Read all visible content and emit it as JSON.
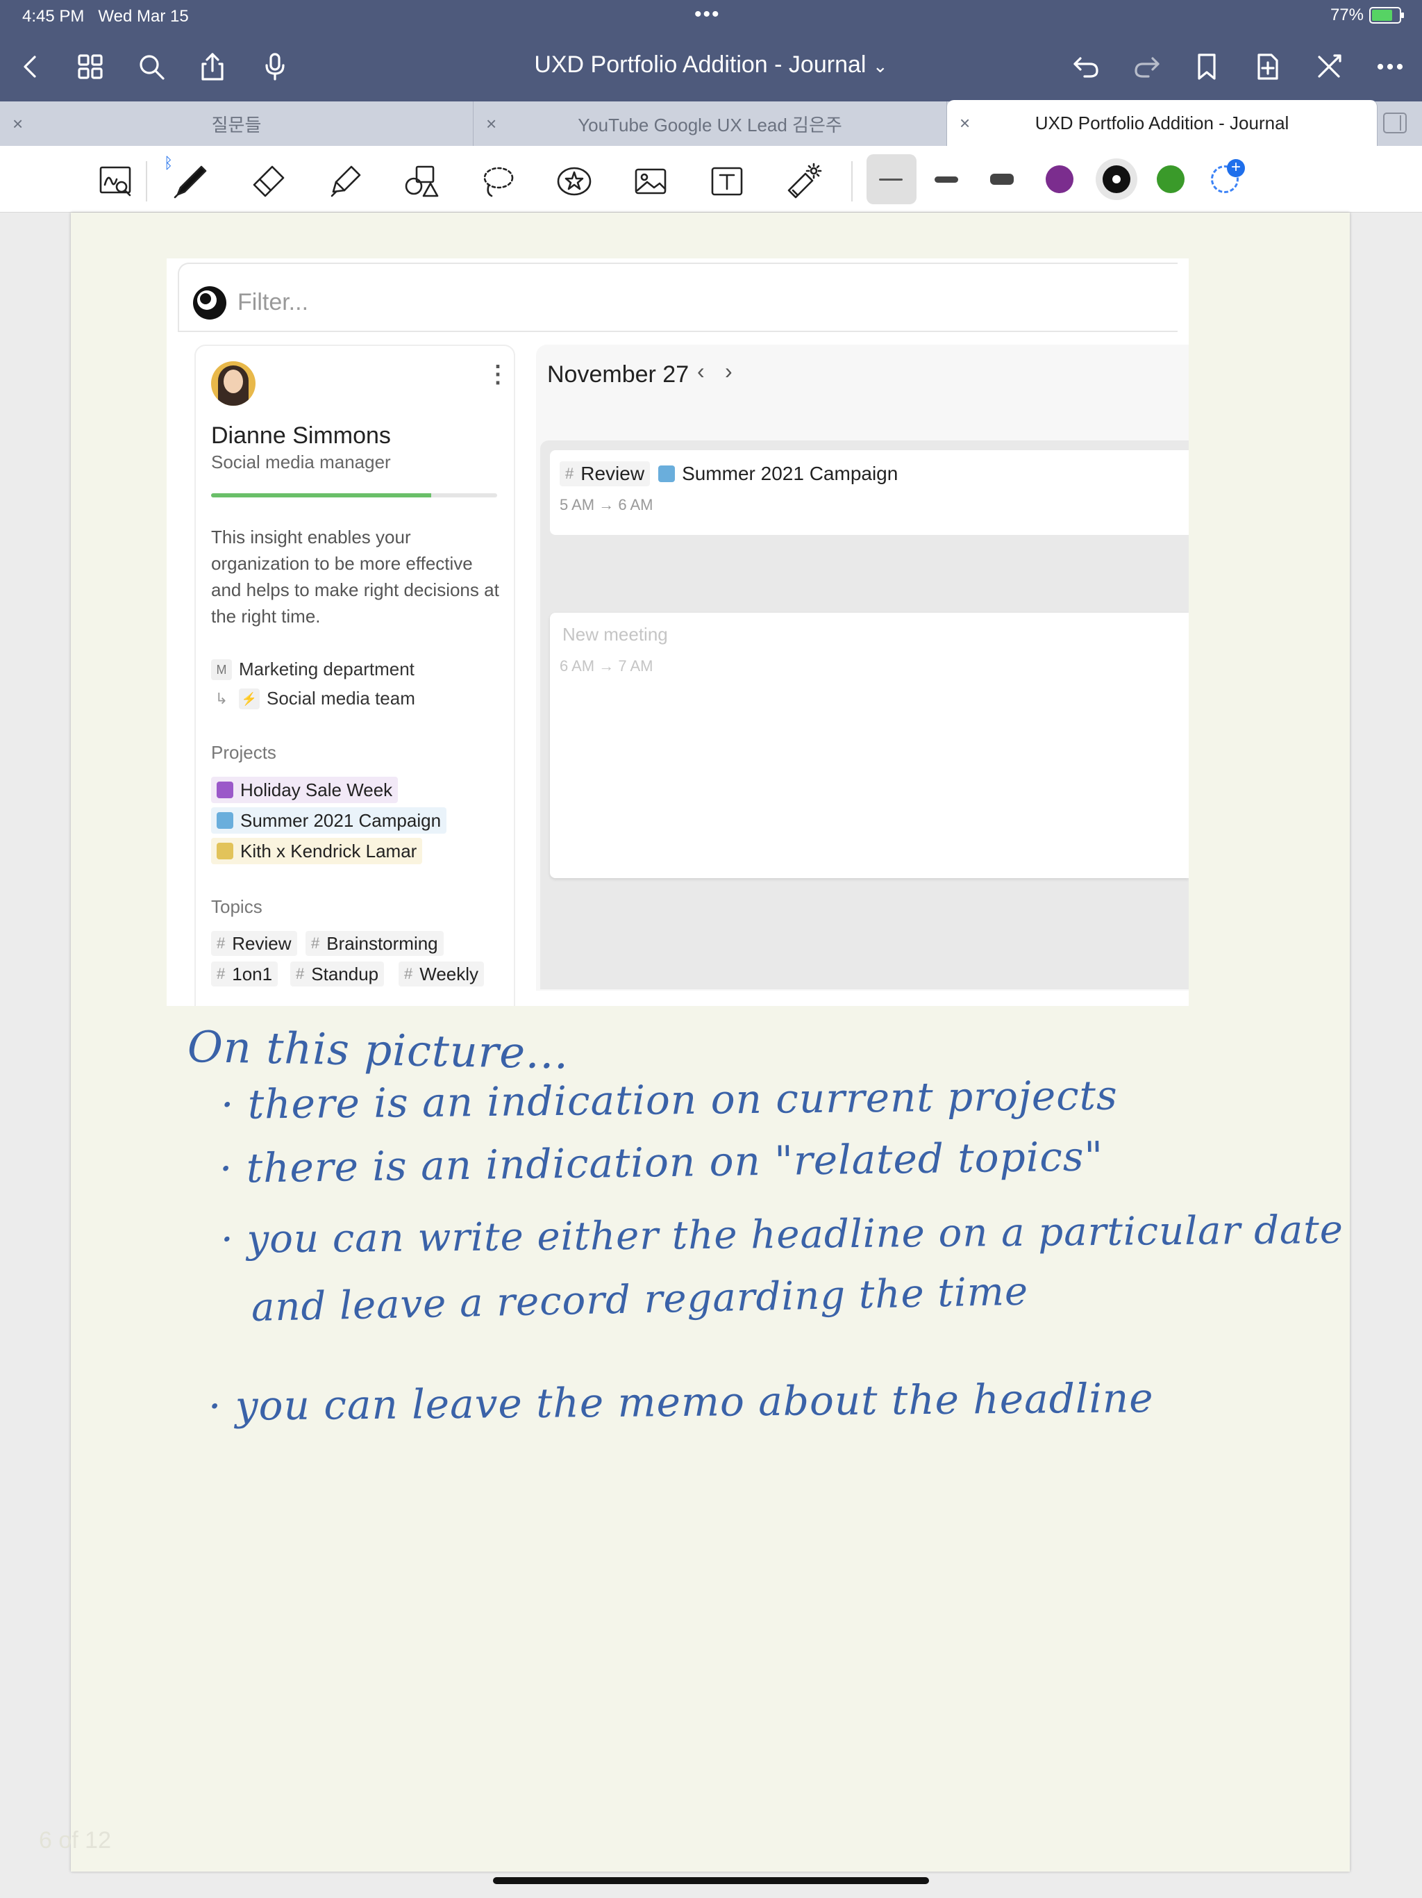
{
  "status": {
    "time": "4:45 PM",
    "date": "Wed Mar 15",
    "dots": "•••",
    "battery": "77%"
  },
  "nav": {
    "title": "UXD Portfolio Addition - Journal",
    "chevron": "⌄",
    "left_icons": [
      "back-icon",
      "grid-icon",
      "search-icon",
      "share-icon",
      "mic-icon"
    ],
    "right_icons": [
      "undo-icon",
      "redo-icon",
      "bookmark-icon",
      "add-page-icon",
      "close-tools-icon",
      "more-icon"
    ]
  },
  "tabs": [
    {
      "label": "질문들",
      "close": "×"
    },
    {
      "label": "YouTube Google UX Lead 김은주",
      "close": "×"
    },
    {
      "label": "UXD Portfolio Addition - Journal",
      "close": "×"
    }
  ],
  "toolbar": {
    "tools": [
      "zoom-write-tool-icon",
      "pen-icon",
      "eraser-icon",
      "highlighter-icon",
      "shapes-icon",
      "lasso-icon",
      "sticker-icon",
      "image-icon",
      "text-icon",
      "laser-pointer-icon"
    ],
    "colors": [
      "#7b2d8e",
      "#111111",
      "#3a9a2a"
    ]
  },
  "screenshot": {
    "filter_placeholder": "Filter...",
    "profile": {
      "name": "Dianne Simmons",
      "role": "Social media manager",
      "progress": 0.77,
      "insight": "This insight enables your organization to be more effective and helps to make right decisions at the right time.",
      "dept_badge": "M",
      "department": "Marketing department",
      "team_arrow": "↳",
      "team_badge": "⚡",
      "team": "Social media team",
      "projects_label": "Projects",
      "projects": [
        {
          "name": "Holiday Sale Week",
          "color": "#9b59c9",
          "bg": "#f2e9f7"
        },
        {
          "name": "Summer 2021 Campaign",
          "color": "#6aaedc",
          "bg": "#eaf3fa"
        },
        {
          "name": "Kith x Kendrick Lamar",
          "color": "#e2c35a",
          "bg": "#faf4df"
        }
      ],
      "topics_label": "Topics",
      "topics": [
        "Review",
        "Brainstorming",
        "1on1",
        "Standup",
        "Weekly"
      ],
      "hash": "#"
    },
    "calendar": {
      "date": "November 27",
      "prev": "‹",
      "next": "›",
      "event1": {
        "tag": "Review",
        "project": "Summer 2021 Campaign",
        "project_color": "#6aaedc",
        "time": "5 AM → 6 AM"
      },
      "event2": {
        "title": "New meeting",
        "time": "6 AM → 7 AM"
      }
    }
  },
  "notes": [
    "On this picture...",
    "· there is an indication on current projects",
    "· there is an indication on \"related topics\"",
    "· you can write either the headline on a particular date",
    "and leave a record regarding the time",
    "· you can leave the memo about the headline"
  ],
  "page_count": "6 of 12"
}
